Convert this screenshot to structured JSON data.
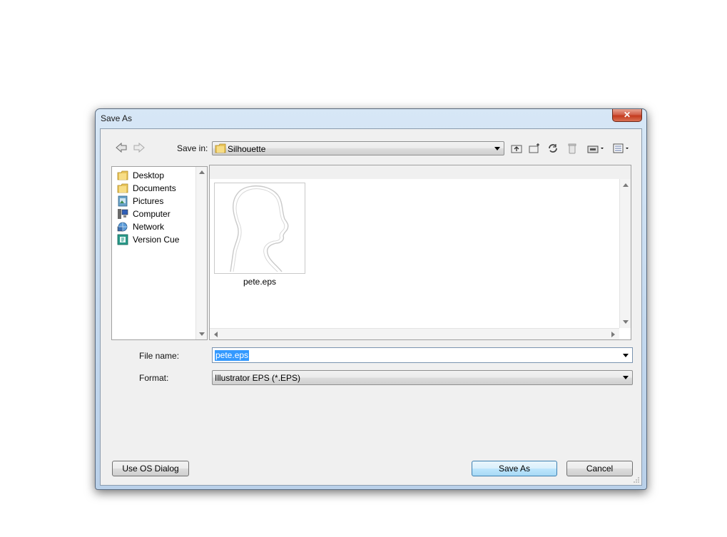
{
  "window": {
    "title": "Save As",
    "close_glyph": "✕"
  },
  "toolbar": {
    "save_in_label": "Save in:",
    "folder": "Silhouette",
    "icons": [
      "back-arrow-icon",
      "forward-arrow-icon",
      "up-folder-icon",
      "new-folder-icon",
      "refresh-icon",
      "delete-icon",
      "tools-icon",
      "view-menu-icon"
    ]
  },
  "places": [
    {
      "label": "Desktop",
      "icon": "folder-icon"
    },
    {
      "label": "Documents",
      "icon": "folder-icon"
    },
    {
      "label": "Pictures",
      "icon": "pictures-icon"
    },
    {
      "label": "Computer",
      "icon": "computer-icon"
    },
    {
      "label": "Network",
      "icon": "network-icon"
    },
    {
      "label": "Version Cue",
      "icon": "version-cue-icon"
    }
  ],
  "files": [
    {
      "name": "pete.eps"
    }
  ],
  "form": {
    "file_name_label": "File name:",
    "file_name_value": "pete.eps",
    "format_label": "Format:",
    "format_value": "Illustrator EPS (*.EPS)"
  },
  "buttons": {
    "os_dialog": "Use OS Dialog",
    "save": "Save As",
    "cancel": "Cancel"
  },
  "colors": {
    "selection": "#3399ff",
    "title_bar": "#c3d8ee",
    "close_button": "#c43a1d"
  }
}
